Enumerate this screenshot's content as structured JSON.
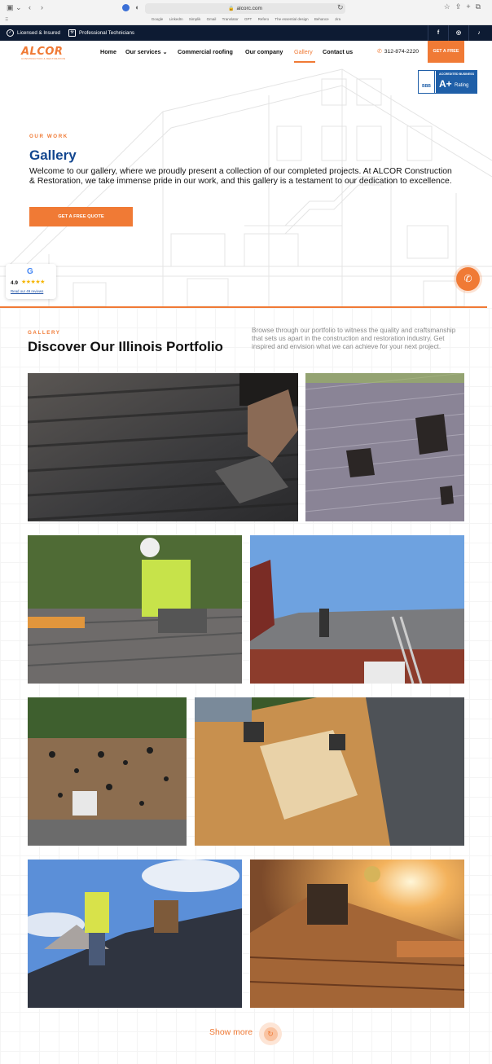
{
  "browser": {
    "url": "alcorc.com",
    "bookmarks": [
      "Google",
      "LinkedIn",
      "Simplik",
      "Gmail",
      "Translator",
      "GPT",
      "Refero",
      "The essential design",
      "Behance",
      "Jira"
    ]
  },
  "topbar": {
    "licensed": "Licensed & Insured",
    "technicians": "Professional Technicians",
    "social": {
      "facebook": "f",
      "instagram": "◎",
      "tiktok": "♪"
    }
  },
  "nav": {
    "logo_word": "ALCOR",
    "logo_tag": "CONSTRUCTION & RESTORATION",
    "home": "Home",
    "services": "Our services",
    "commercial": "Commercial roofing",
    "company": "Our company",
    "gallery": "Gallery",
    "contact": "Contact us",
    "phone": "312-874-2220",
    "cta": "GET A FREE QUOTE"
  },
  "bbb": {
    "logo": "BBB",
    "accredited": "ACCREDITED BUSINESS",
    "rating": "A+",
    "rating_label": "Rating"
  },
  "hero": {
    "eyebrow": "OUR WORK",
    "title": "Gallery",
    "description": "Welcome to our gallery, where we proudly present a collection of our completed projects. At ALCOR Construction & Restoration, we take immense pride in our work, and this gallery is a testament to our dedication to excellence.",
    "button": "GET A FREE QUOTE"
  },
  "review": {
    "logo": "G",
    "score": "4.9",
    "stars": "★★★★★",
    "link": "Read our 49 reviews"
  },
  "portfolio": {
    "eyebrow": "GALLERY",
    "title": "Discover Our Illinois Portfolio",
    "description": "Browse through our portfolio to witness the quality and craftsmanship that sets us apart in the construction and restoration industry. Get inspired and envision what we can achieve for your next project.",
    "show_more": "Show more",
    "show_more_icon": "↻"
  },
  "colors": {
    "accent": "#f07a35",
    "navy": "#0d1b33",
    "title_blue": "#12468f"
  }
}
